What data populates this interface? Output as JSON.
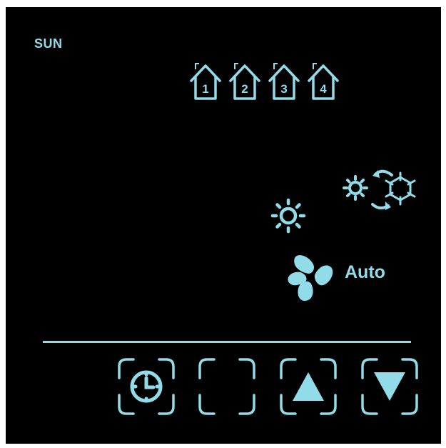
{
  "display": {
    "day": "SUN",
    "zones": [
      {
        "label": "1",
        "icon": "house-icon"
      },
      {
        "label": "2",
        "icon": "house-icon"
      },
      {
        "label": "3",
        "icon": "house-icon"
      },
      {
        "label": "4",
        "icon": "house-icon"
      }
    ],
    "mode_change_icons": [
      "sun-icon",
      "snowflake-icon",
      "refresh-arrows-icon"
    ],
    "mode_icon": "sun-icon",
    "fan": {
      "icon": "fan-icon",
      "label": "Auto"
    }
  },
  "buttons": [
    {
      "name": "clock-button",
      "icon": "clock-icon"
    },
    {
      "name": "blank-button",
      "icon": ""
    },
    {
      "name": "up-button",
      "icon": "triangle-up-icon"
    },
    {
      "name": "down-button",
      "icon": "triangle-down-icon"
    }
  ],
  "colors": {
    "background": "#000000",
    "lcd": "#92dbe8"
  }
}
